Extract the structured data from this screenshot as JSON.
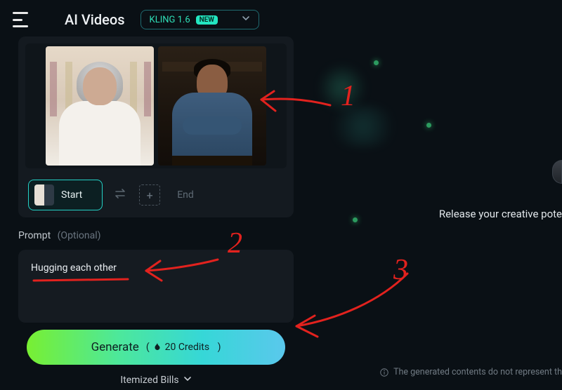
{
  "header": {
    "title": "AI Videos",
    "model_name": "KLING 1.6",
    "new_badge": "NEW"
  },
  "frames": {
    "start_label": "Start",
    "end_label": "End"
  },
  "prompt": {
    "label": "Prompt",
    "optional": "(Optional)",
    "value": "Hugging each other"
  },
  "generate": {
    "label": "Generate",
    "credits_prefix": "(",
    "credits_value": "20 Credits",
    "credits_suffix": ")"
  },
  "itemized_label": "Itemized Bills",
  "right": {
    "tagline": "Release your creative pote",
    "disclaimer": "The generated contents do not represent th"
  },
  "annotations": {
    "n1": "1",
    "n2": "2",
    "n3": "3"
  }
}
